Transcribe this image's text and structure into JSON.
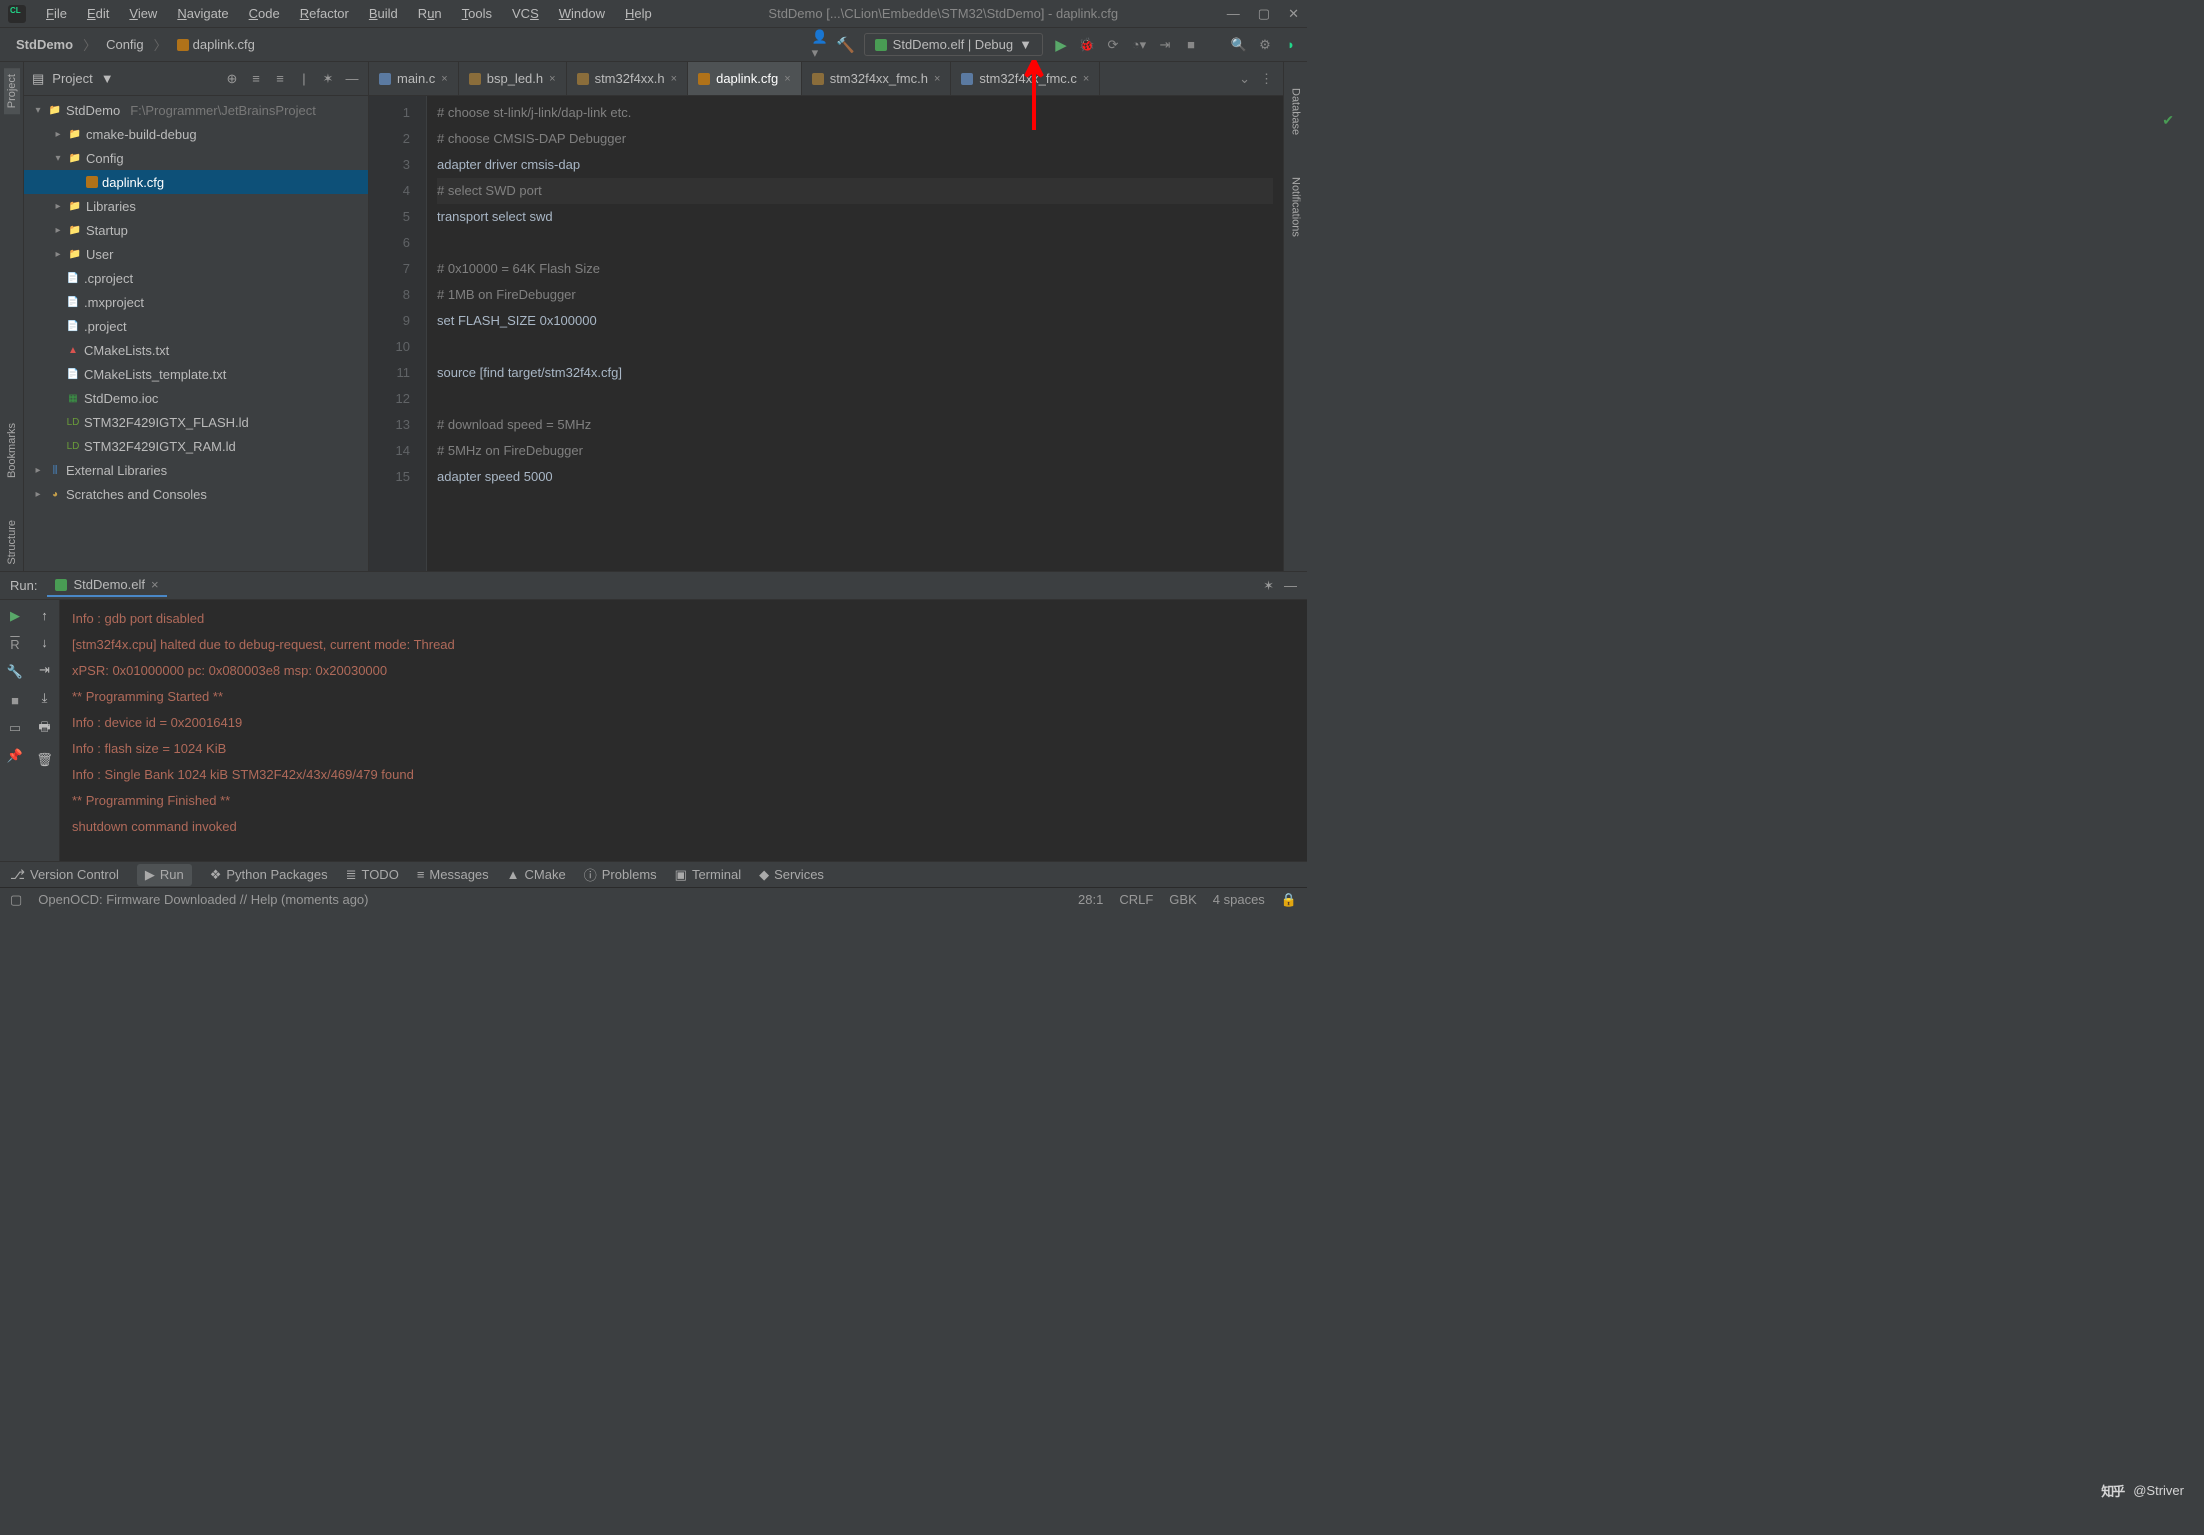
{
  "title": "StdDemo [...\\CLion\\Embedde\\STM32\\StdDemo] - daplink.cfg",
  "menus": [
    "File",
    "Edit",
    "View",
    "Navigate",
    "Code",
    "Refactor",
    "Build",
    "Run",
    "Tools",
    "VCS",
    "Window",
    "Help"
  ],
  "breadcrumbs": [
    "StdDemo",
    "Config",
    "daplink.cfg"
  ],
  "runConfig": "StdDemo.elf | Debug",
  "projectPanel": {
    "title": "Project"
  },
  "tree": {
    "root": "StdDemo",
    "rootHint": "F:\\Programmer\\JetBrainsProject",
    "items": [
      "cmake-build-debug",
      "Config",
      "daplink.cfg",
      "Libraries",
      "Startup",
      "User",
      ".cproject",
      ".mxproject",
      ".project",
      "CMakeLists.txt",
      "CMakeLists_template.txt",
      "StdDemo.ioc",
      "STM32F429IGTX_FLASH.ld",
      "STM32F429IGTX_RAM.ld"
    ],
    "extLib": "External Libraries",
    "scratch": "Scratches and Consoles"
  },
  "tabs": [
    "main.c",
    "bsp_led.h",
    "stm32f4xx.h",
    "daplink.cfg",
    "stm32f4xx_fmc.h",
    "stm32f4xx_fmc.c"
  ],
  "code": {
    "lines": [
      "# choose st-link/j-link/dap-link etc.",
      "# choose CMSIS-DAP Debugger",
      "adapter driver cmsis-dap",
      "# select SWD port",
      "transport select swd",
      "",
      "# 0x10000 = 64K Flash Size",
      "# 1MB on FireDebugger",
      "set FLASH_SIZE 0x100000",
      "",
      "source [find target/stm32f4x.cfg]",
      "",
      "# download speed = 5MHz",
      "# 5MHz on FireDebugger",
      "adapter speed 5000"
    ]
  },
  "run": {
    "label": "Run:",
    "tab": "StdDemo.elf",
    "lines": [
      "Info : gdb port disabled",
      "[stm32f4x.cpu] halted due to debug-request, current mode: Thread",
      "xPSR: 0x01000000 pc: 0x080003e8 msp: 0x20030000",
      "** Programming Started **",
      "Info : device id = 0x20016419",
      "Info : flash size = 1024 KiB",
      "Info : Single Bank 1024 kiB STM32F42x/43x/469/479 found",
      "** Programming Finished **",
      "shutdown command invoked"
    ]
  },
  "bottomBar": {
    "items": [
      "Version Control",
      "Run",
      "Python Packages",
      "TODO",
      "Messages",
      "CMake",
      "Problems",
      "Terminal",
      "Services"
    ]
  },
  "status": {
    "msg": "OpenOCD: Firmware Downloaded // Help (moments ago)",
    "pos": "28:1",
    "eol": "CRLF",
    "enc": "GBK",
    "indent": "4 spaces"
  },
  "rightRail": [
    "Database",
    "Notifications"
  ],
  "leftRail": [
    "Project",
    "Bookmarks",
    "Structure"
  ],
  "watermark": "知乎 @Striver"
}
